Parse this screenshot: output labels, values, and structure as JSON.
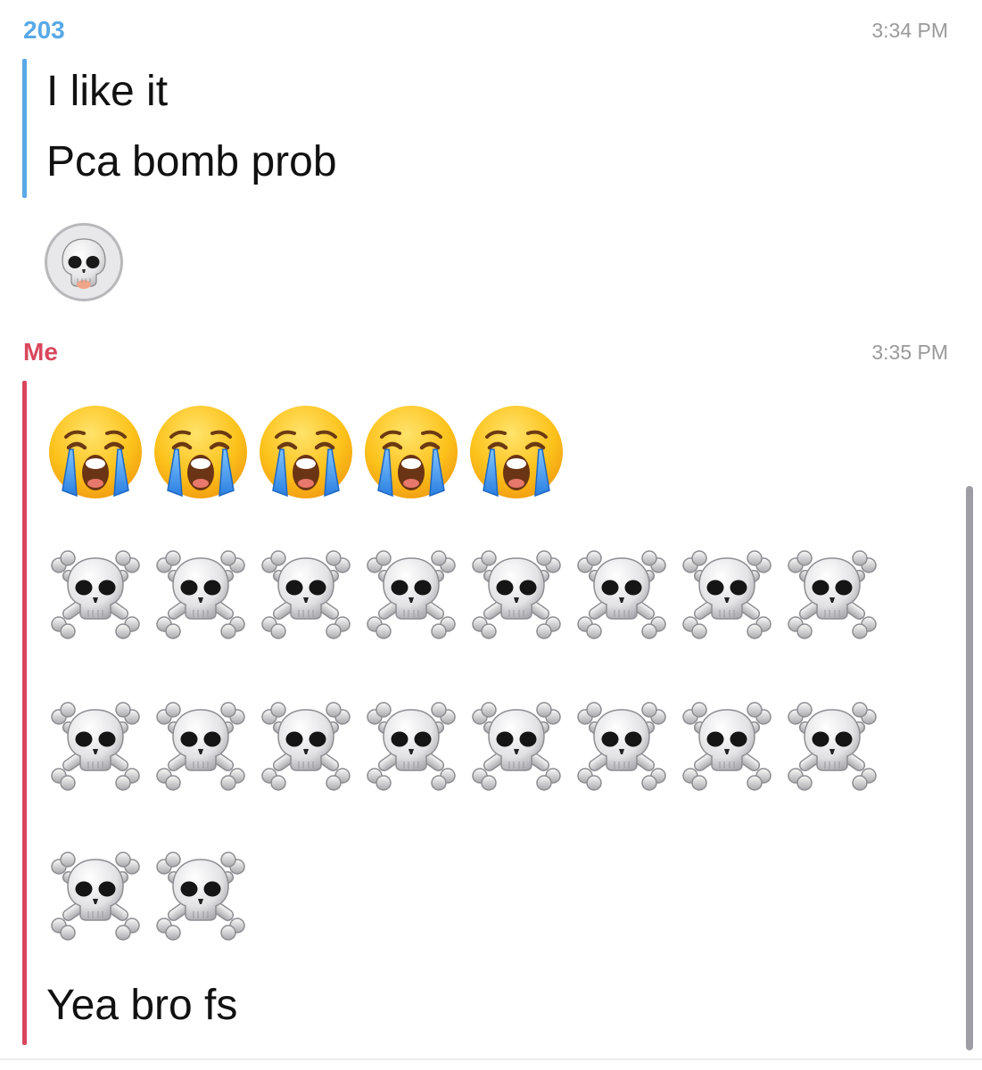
{
  "thread": {
    "messages": [
      {
        "sender": "203",
        "sender_color": "#58a9e8",
        "time": "3:34 PM",
        "lines": [
          "I like it",
          "Pca bomb prob"
        ],
        "reaction": "skull-icon"
      },
      {
        "sender": "Me",
        "sender_color": "#d9475d",
        "time": "3:35 PM",
        "emoji_lines": [
          {
            "emoji": "loudly-crying-face",
            "count": 5
          },
          {
            "emoji": "skull-and-crossbones",
            "count": 8
          },
          {
            "emoji": "skull-and-crossbones",
            "count": 8
          },
          {
            "emoji": "skull-and-crossbones",
            "count": 2
          }
        ],
        "lines": [
          "Yea bro fs"
        ]
      }
    ]
  }
}
